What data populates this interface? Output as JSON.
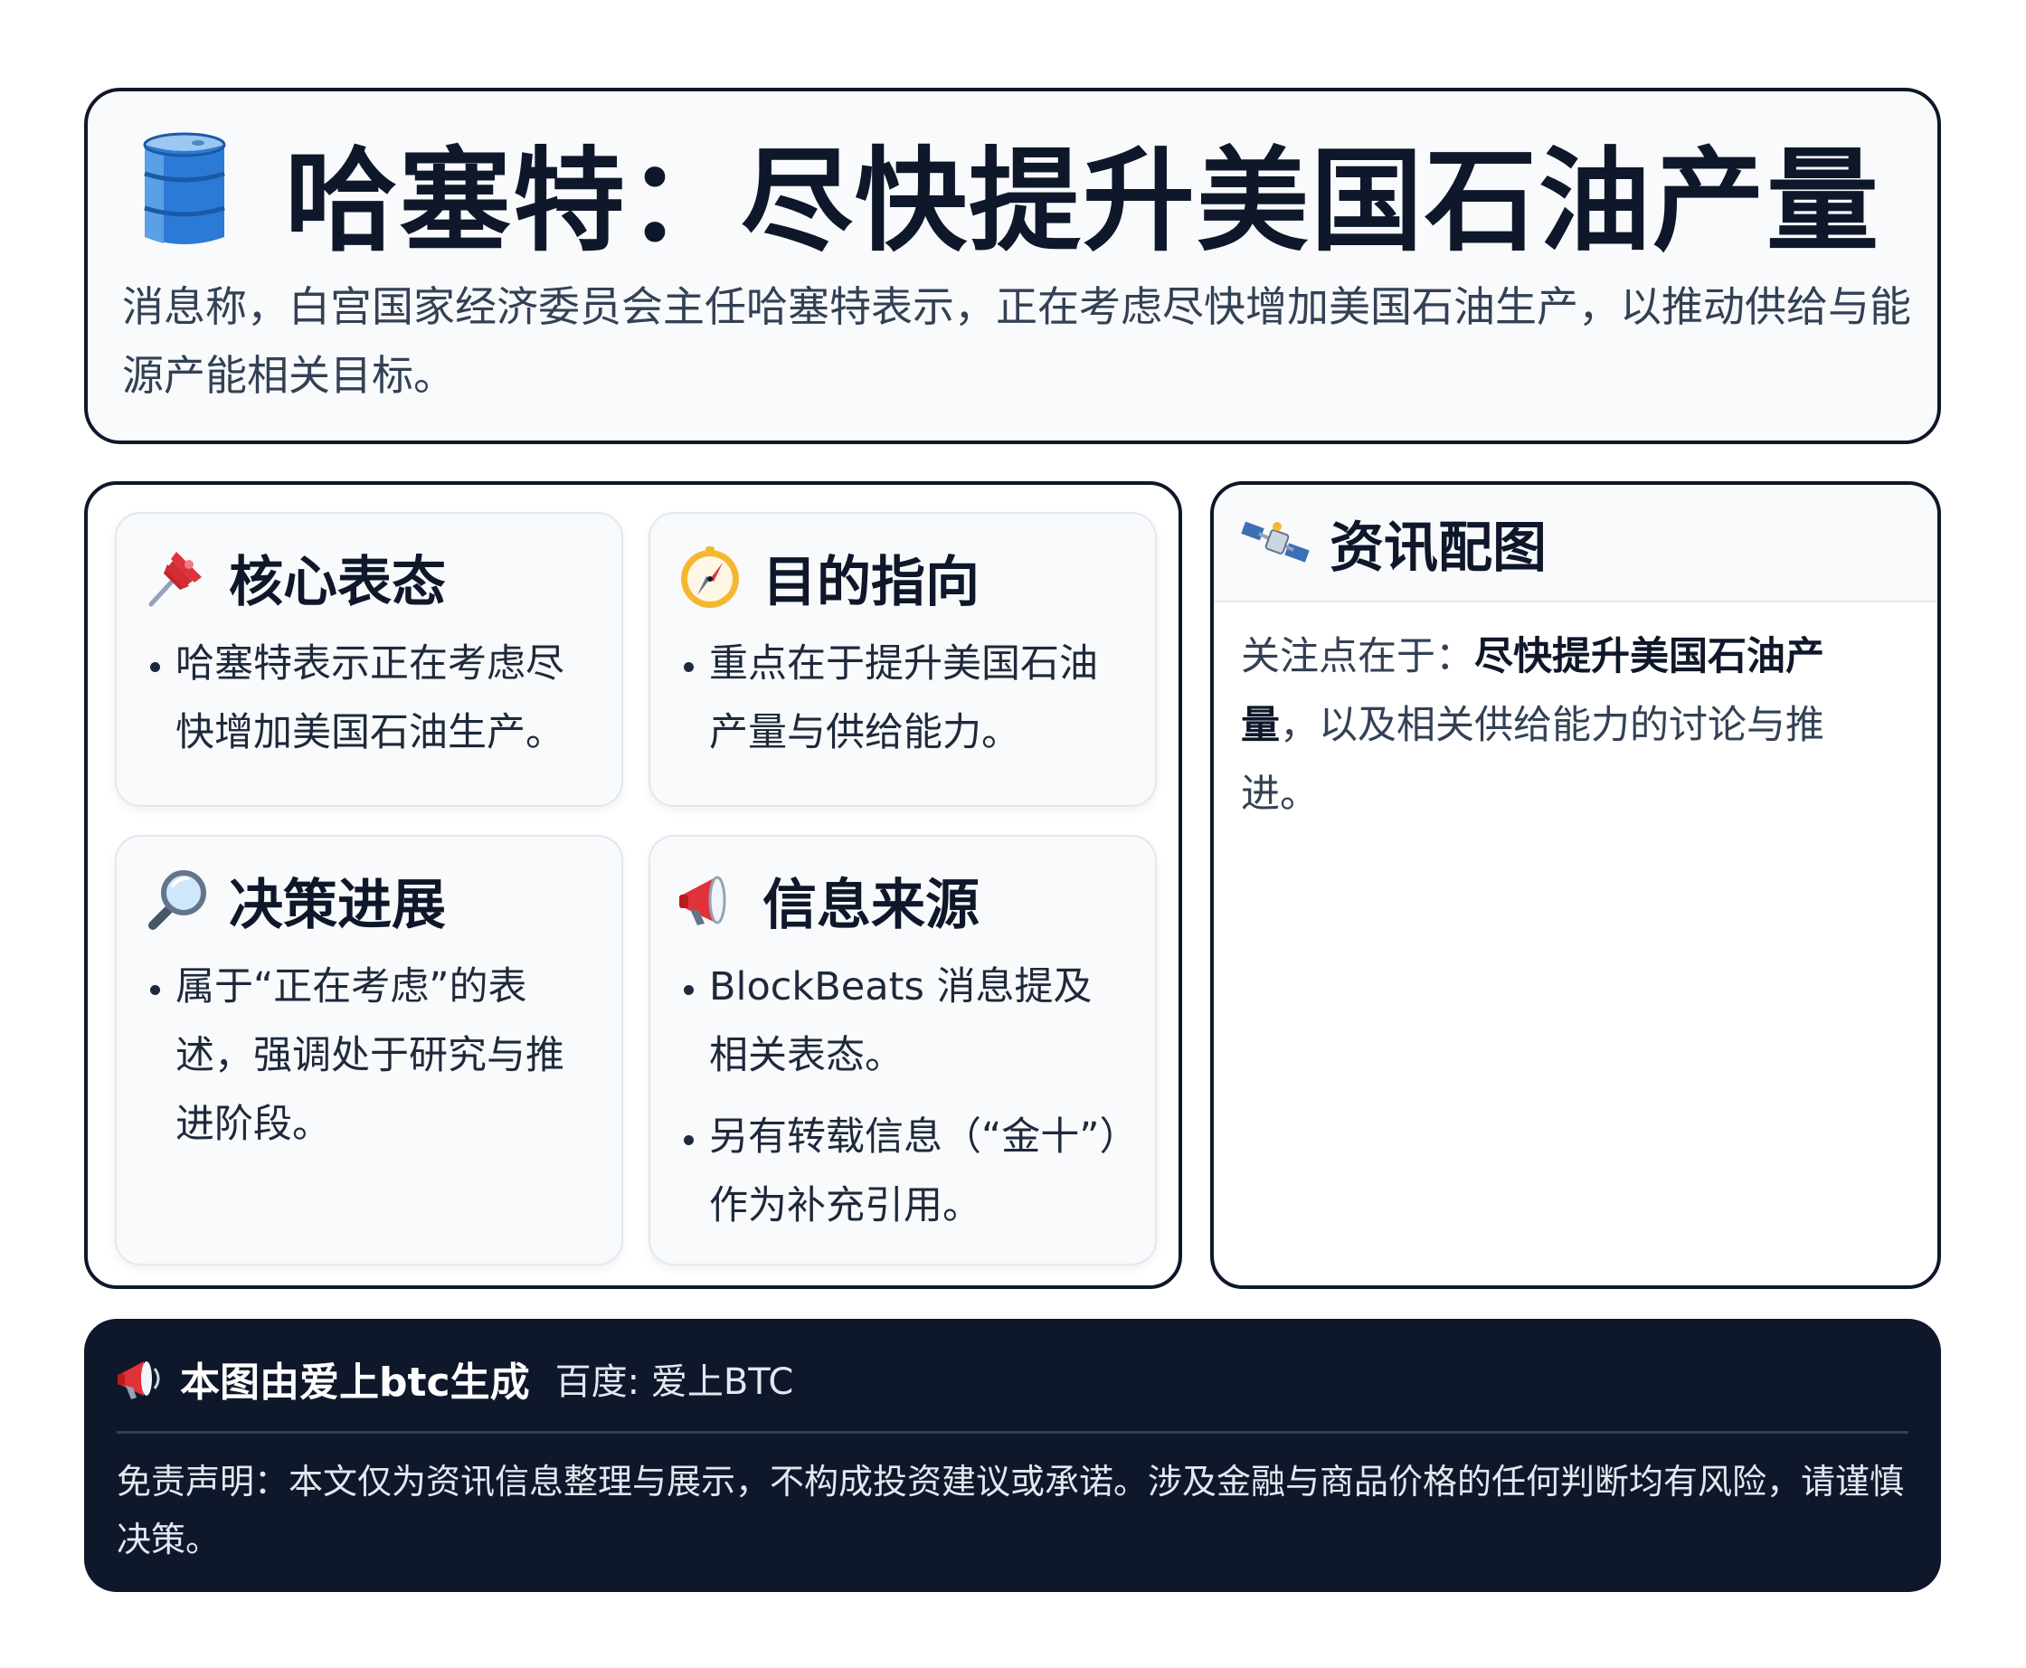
{
  "header": {
    "icon": "oil-barrel-icon",
    "title": "哈塞特：尽快提升美国石油产量",
    "summary": "消息称，白宫国家经济委员会主任哈塞特表示，正在考虑尽快增加美国石油生产，以推动供给与能源产能相关目标。"
  },
  "cards": [
    {
      "icon": "pushpin-icon",
      "title": "核心表态",
      "items": [
        "哈塞特表示正在考虑尽快增加美国石油生产。"
      ]
    },
    {
      "icon": "compass-icon",
      "title": "目的指向",
      "items": [
        "重点在于提升美国石油产量与供给能力。"
      ]
    },
    {
      "icon": "magnifier-icon",
      "title": "决策进展",
      "items": [
        "属于“正在考虑”的表述，强调处于研究与推进阶段。"
      ]
    },
    {
      "icon": "megaphone-icon",
      "title": "信息来源",
      "items": [
        "BlockBeats 消息提及相关表态。",
        "另有转载信息（“金十”）作为补充引用。"
      ]
    }
  ],
  "side_panel": {
    "icon": "satellite-icon",
    "title": "资讯配图",
    "lead": "关注点在于：",
    "highlight": "尽快提升美国石油产量",
    "tail": "，以及相关供给能力的讨论与推进。"
  },
  "footer": {
    "icon": "loudspeaker-icon",
    "brand": "本图由爱上btc生成",
    "source": "百度: 爱上BTC",
    "disclaimer": "免责声明：本文仅为资讯信息整理与展示，不构成投资建议或承诺。涉及金融与商品价格的任何判断均有风险，请谨慎决策。"
  },
  "colors": {
    "ink": "#0f172a",
    "card_bg": "#f8fafc",
    "card_border": "#e2e8f0",
    "barrel_blue": "#2b7bd6",
    "footer_bg": "#0f172a"
  }
}
